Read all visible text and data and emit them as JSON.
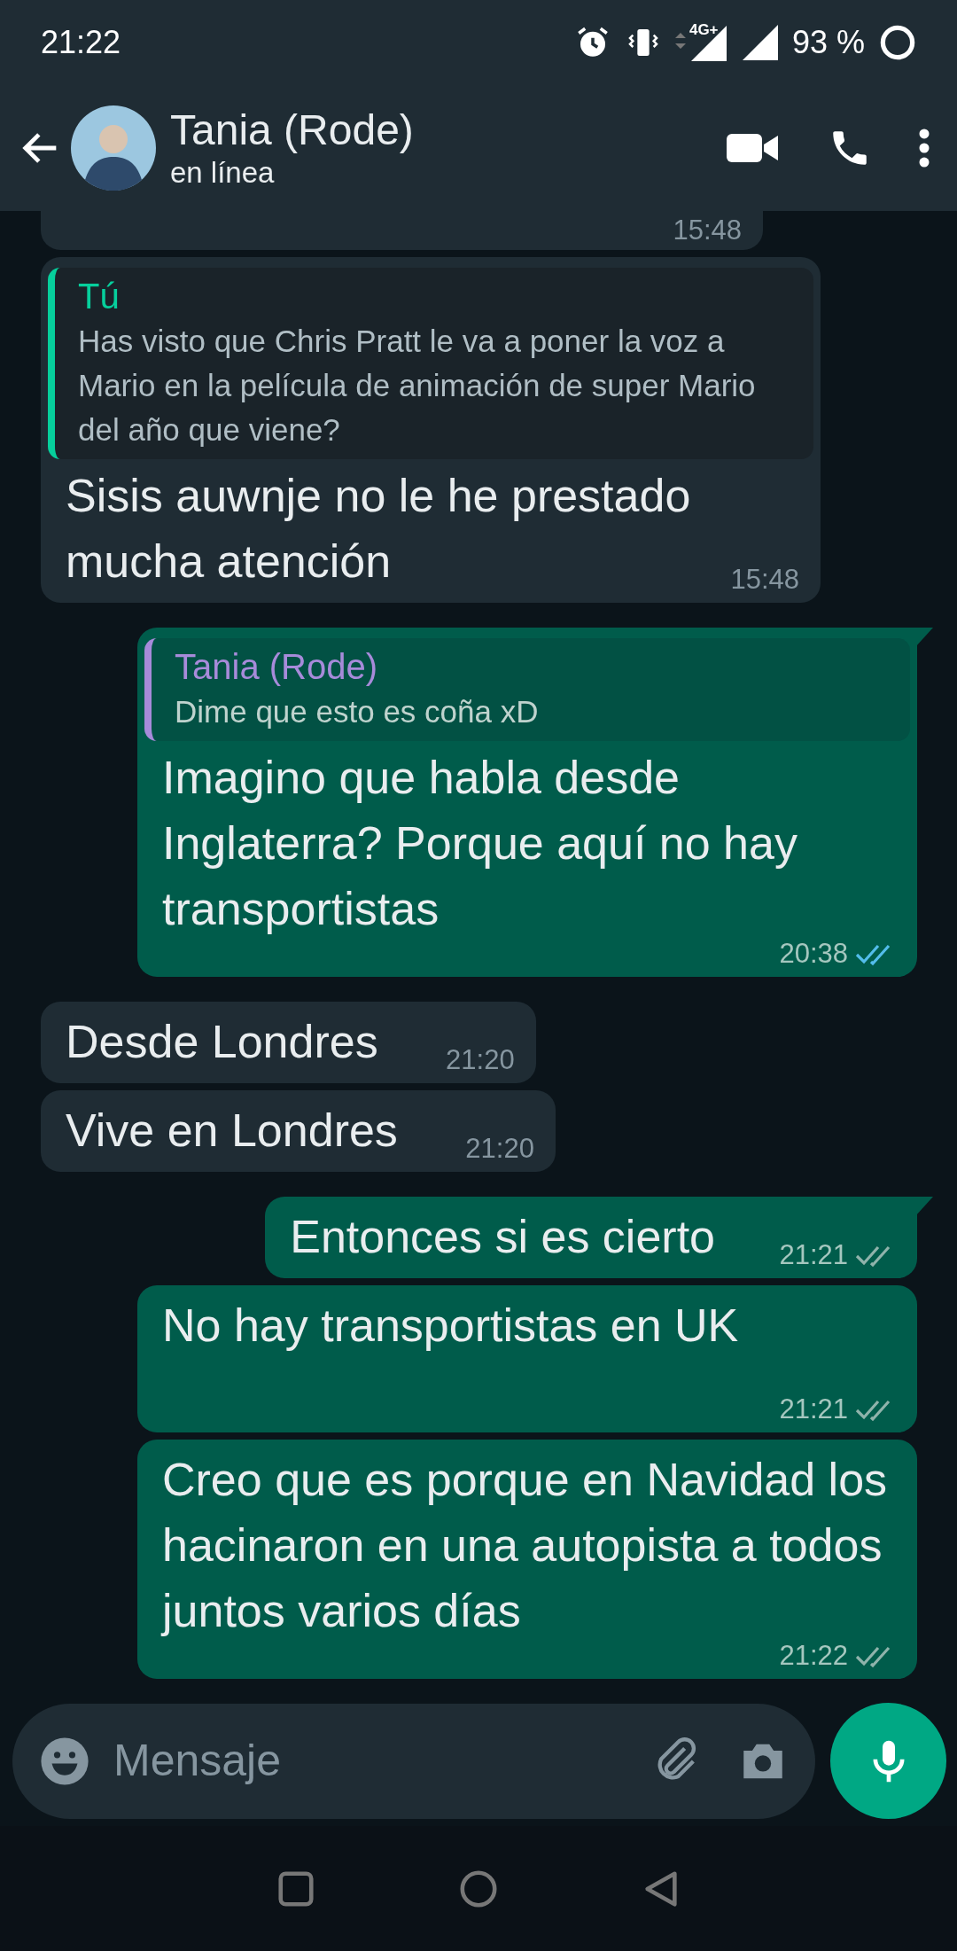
{
  "status_bar": {
    "time": "21:22",
    "network": "4G+",
    "battery": "93 %"
  },
  "header": {
    "name": "Tania (Rode)",
    "subtitle": "en línea"
  },
  "messages": [
    {
      "kind": "incoming",
      "partial": true,
      "time": "15:48"
    },
    {
      "kind": "incoming",
      "quote": {
        "author": "Tú",
        "text": "Has visto que Chris Pratt le va a poner la voz a Mario en la película de animación de super Mario del año que viene?",
        "color": "#06cf9c"
      },
      "text": "Sisis auwnje no le he prestado mucha atención",
      "time": "15:48"
    },
    {
      "kind": "outgoing",
      "quote": {
        "author": "Tania (Rode)",
        "text": "Dime que esto es coña xD",
        "color": "#a78bda"
      },
      "text": "Imagino que habla desde Inglaterra? Porque aquí no hay transportistas",
      "time": "20:38",
      "read": true
    },
    {
      "kind": "incoming",
      "text": "Desde Londres",
      "time": "21:20"
    },
    {
      "kind": "incoming",
      "text": "Vive en Londres",
      "time": "21:20"
    },
    {
      "kind": "outgoing",
      "text": "Entonces si es cierto",
      "time": "21:21",
      "read": false
    },
    {
      "kind": "outgoing",
      "text": "No hay transportistas en UK",
      "time": "21:21",
      "read": false
    },
    {
      "kind": "outgoing",
      "text": "Creo que es porque en Navidad los hacinaron en una autopista a todos juntos varios días",
      "time": "21:22",
      "read": false
    }
  ],
  "composer": {
    "placeholder": "Mensaje"
  }
}
